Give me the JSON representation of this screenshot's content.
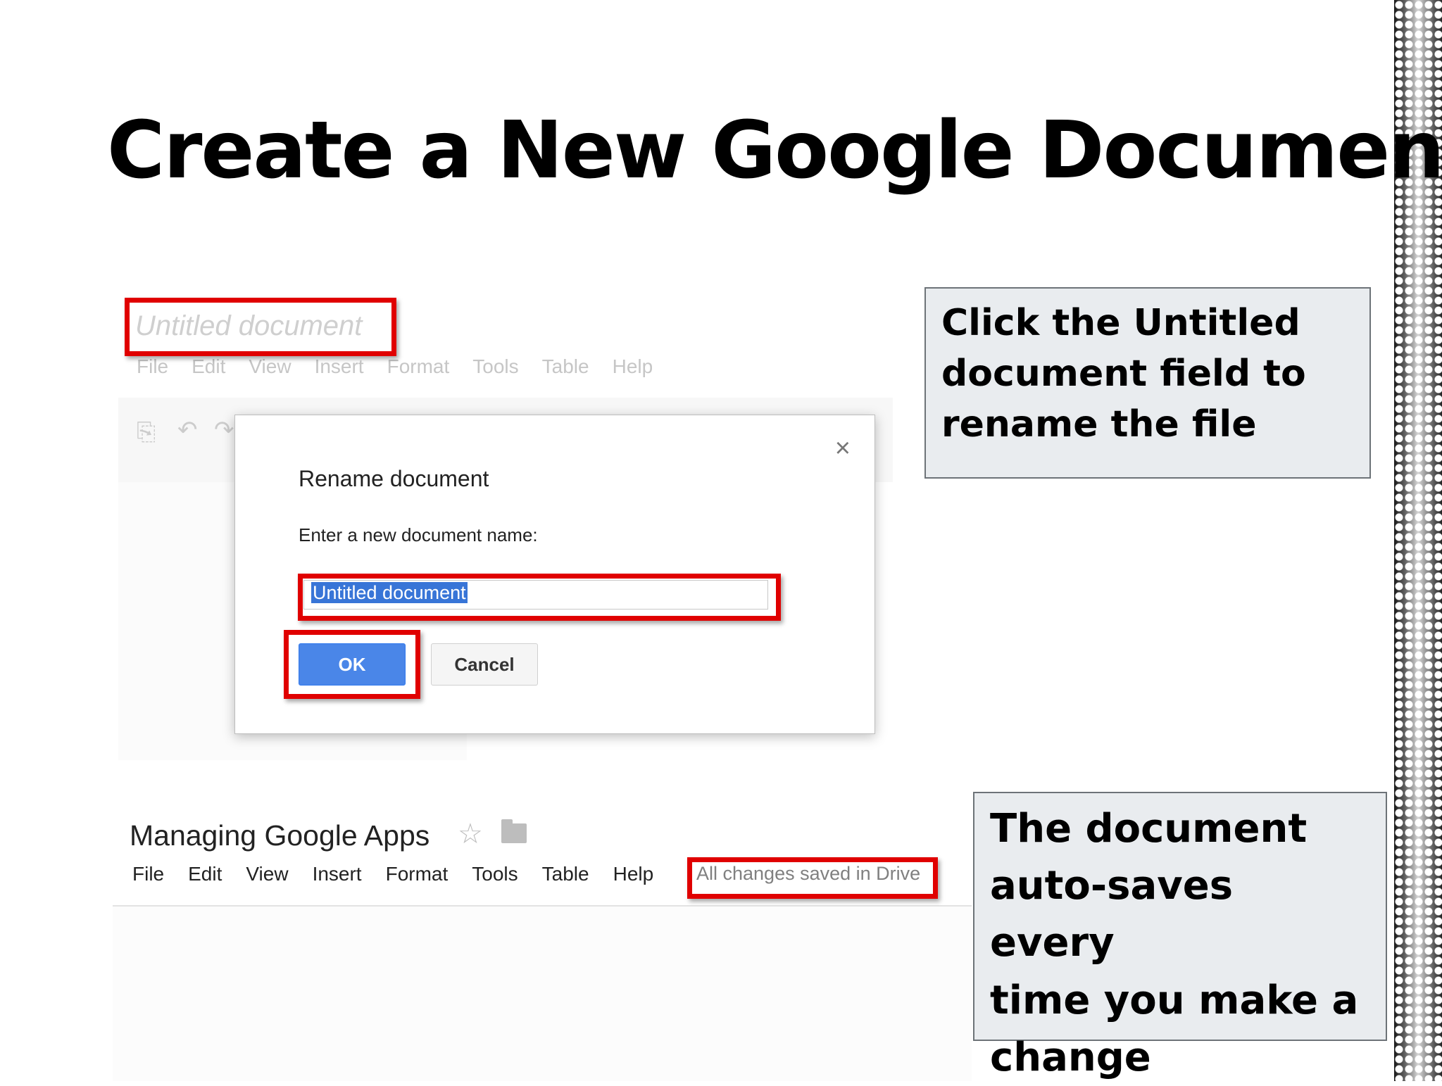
{
  "slide": {
    "title": "Create a New Google Document"
  },
  "screenshot_top": {
    "doc_title": "Untitled document",
    "menu": [
      "File",
      "Edit",
      "View",
      "Insert",
      "Format",
      "Tools",
      "Table",
      "Help"
    ],
    "dialog": {
      "title": "Rename document",
      "prompt": "Enter a new document name:",
      "input_value": "Untitled document",
      "ok_label": "OK",
      "cancel_label": "Cancel",
      "close_label": "×"
    }
  },
  "callouts": {
    "rename": [
      "Click the Untitled",
      "document field to",
      "rename the file"
    ],
    "autosave": [
      "The document",
      "auto-saves every",
      "time you make a",
      "change"
    ]
  },
  "screenshot_bottom": {
    "doc_title": "Managing Google Apps",
    "star_glyph": "☆",
    "menu": [
      "File",
      "Edit",
      "View",
      "Insert",
      "Format",
      "Tools",
      "Table",
      "Help"
    ],
    "save_status": "All changes saved in Drive"
  },
  "icons": {
    "print": "printer-icon",
    "undo": "undo-icon",
    "redo": "redo-icon",
    "star": "star-icon",
    "folder": "folder-icon",
    "close": "close-icon"
  },
  "colors": {
    "highlight_red": "#e00000",
    "ok_button_blue": "#4a86e8",
    "selection_blue": "#3875d7",
    "callout_bg": "#e9ecef"
  }
}
